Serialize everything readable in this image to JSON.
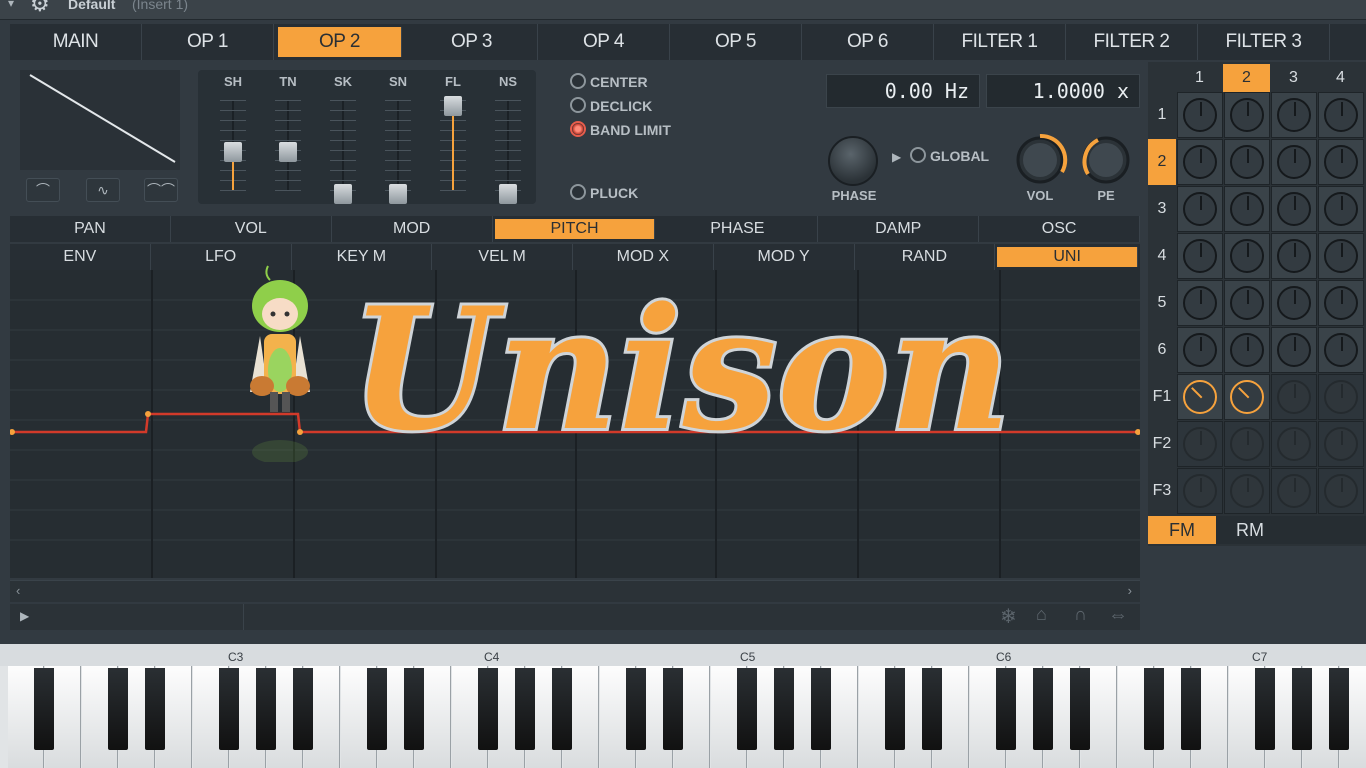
{
  "title": {
    "preset": "Default",
    "insert": "(Insert 1)"
  },
  "tabs": [
    {
      "label": "MAIN",
      "sel": false,
      "mk": false
    },
    {
      "label": "OP 1",
      "sel": false,
      "mk": true
    },
    {
      "label": "OP 2",
      "sel": true,
      "mk": false
    },
    {
      "label": "OP 3",
      "sel": false,
      "mk": false
    },
    {
      "label": "OP 4",
      "sel": false,
      "mk": false
    },
    {
      "label": "OP 5",
      "sel": false,
      "mk": false
    },
    {
      "label": "OP 6",
      "sel": false,
      "mk": false
    },
    {
      "label": "FILTER 1",
      "sel": false,
      "mk": true
    },
    {
      "label": "FILTER 2",
      "sel": false,
      "mk": false
    },
    {
      "label": "FILTER 3",
      "sel": false,
      "mk": false
    }
  ],
  "sliders": [
    {
      "label": "SH",
      "level": 0.48,
      "orange": true
    },
    {
      "label": "TN",
      "level": 0.48,
      "orange": false
    },
    {
      "label": "SK",
      "level": 0.0,
      "orange": false
    },
    {
      "label": "SN",
      "level": 0.0,
      "orange": false
    },
    {
      "label": "FL",
      "level": 1.0,
      "orange": true
    },
    {
      "label": "NS",
      "level": 0.0,
      "orange": false
    }
  ],
  "options": {
    "center": "CENTER",
    "declick": "DECLICK",
    "band_limit": "BAND LIMIT",
    "pluck": "PLUCK",
    "global": "GLOBAL"
  },
  "freq_display": "0.00 Hz",
  "ratio_display": "1.0000 x",
  "knobs": {
    "phase": "PHASE",
    "vol": "VOL",
    "pe": "PE"
  },
  "mod_tabs_1": [
    {
      "label": "PAN",
      "sel": false,
      "mk": false
    },
    {
      "label": "VOL",
      "sel": false,
      "mk": true
    },
    {
      "label": "MOD",
      "sel": false,
      "mk": false
    },
    {
      "label": "PITCH",
      "sel": true,
      "mk": false
    },
    {
      "label": "PHASE",
      "sel": false,
      "mk": true
    },
    {
      "label": "DAMP",
      "sel": false,
      "mk": true
    },
    {
      "label": "OSC",
      "sel": false,
      "mk": false
    }
  ],
  "mod_tabs_2": [
    {
      "label": "ENV",
      "sel": false
    },
    {
      "label": "LFO",
      "sel": false
    },
    {
      "label": "KEY M",
      "sel": false
    },
    {
      "label": "VEL M",
      "sel": false
    },
    {
      "label": "MOD X",
      "sel": false
    },
    {
      "label": "MOD Y",
      "sel": false
    },
    {
      "label": "RAND",
      "sel": false
    },
    {
      "label": "UNI",
      "sel": true
    }
  ],
  "matrix": {
    "cols": [
      "1",
      "2",
      "3",
      "4"
    ],
    "selected_col": "2",
    "rows": [
      "1",
      "2",
      "3",
      "4",
      "5",
      "6",
      "F1",
      "F2",
      "F3"
    ],
    "selected_row": "2",
    "fm_label": "FM",
    "rm_label": "RM"
  },
  "piano": {
    "octave_labels": [
      "C3",
      "C4",
      "C5",
      "C6",
      "C7"
    ]
  },
  "logo_text": "Unison",
  "colors": {
    "accent": "#f6a23d",
    "background": "#323a41",
    "envelope_line": "#d23a2a"
  }
}
